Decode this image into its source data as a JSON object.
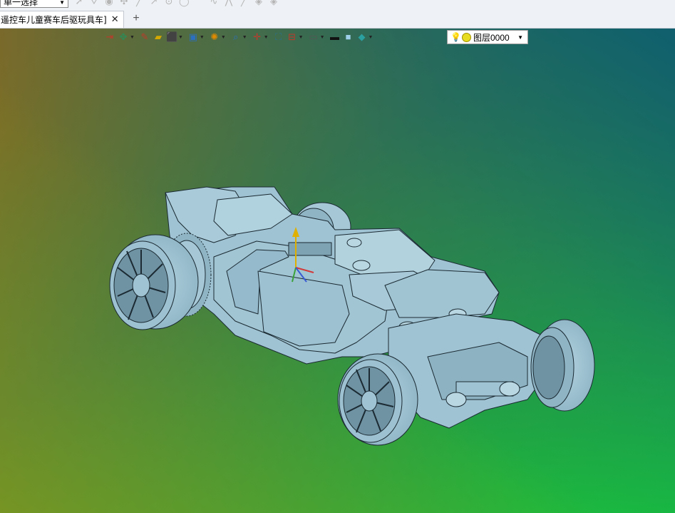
{
  "top_toolbar": {
    "selection_mode": "单一选择"
  },
  "tabs": [
    {
      "label": "遥控车儿童赛车后驱玩具车]",
      "close": "✕"
    }
  ],
  "tab_add_label": "+",
  "viewport_toolbar": {
    "icons": [
      "exit-icon",
      "view-orient-icon",
      "pen-icon",
      "eraser-icon",
      "cube-icon",
      "cube-shaded-icon",
      "render-icon",
      "zoom-icon",
      "axis-icon",
      "fit-icon",
      "dimension-icon",
      "display-icon",
      "line-color-icon",
      "fill-color-icon",
      "plane-icon"
    ],
    "layer_label": "图层0000"
  },
  "colors": {
    "model_fill": "#9fc3d2",
    "model_edge": "#1b2a33",
    "gradient_top_right": "#0f5f6e",
    "gradient_bottom_right": "#19c43c",
    "gradient_left": "#8a6a20"
  }
}
